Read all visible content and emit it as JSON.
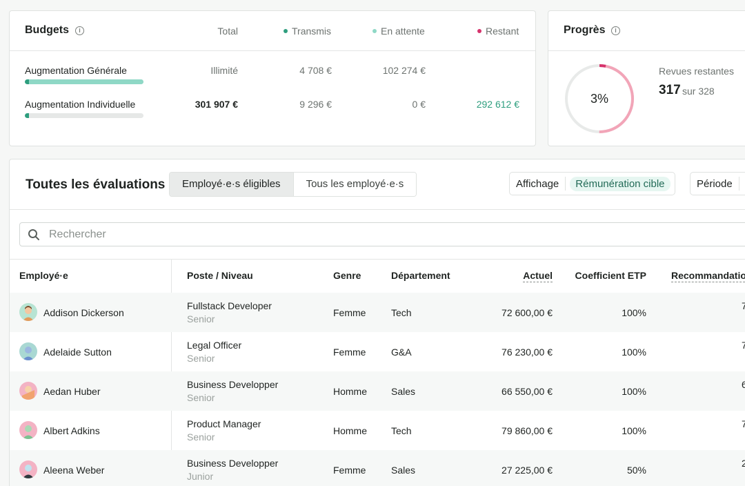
{
  "budgets": {
    "title": "Budgets",
    "columns": {
      "total": "Total",
      "transmis": "Transmis",
      "en_attente": "En attente",
      "restant": "Restant"
    },
    "colors": {
      "transmis": "#2e9e7e",
      "en_attente": "#8fd8c6",
      "restant": "#d6336c"
    },
    "rows": [
      {
        "label": "Augmentation Générale",
        "total": "Illimité",
        "transmis": "4 708 €",
        "en_attente": "102 274 €",
        "restant": "",
        "progress": 1.0
      },
      {
        "label": "Augmentation Individuelle",
        "total": "301 907 €",
        "transmis": "9 296 €",
        "en_attente": "0 €",
        "restant": "292 612 €",
        "progress": 0.03
      }
    ]
  },
  "progress": {
    "title": "Progrès",
    "percent_label": "3%",
    "percent": 0.03,
    "remaining_label": "Revues restantes",
    "remaining": "317",
    "total": "sur 328"
  },
  "evaluations": {
    "title": "Toutes les évaluations",
    "tabs": [
      "Employé·e·s éligibles",
      "Tous les employé·e·s"
    ],
    "display_label": "Affichage",
    "display_value": "Rémunération cible",
    "period_label": "Période",
    "search_placeholder": "Rechercher",
    "headers": {
      "employee": "Employé·e",
      "position": "Poste / Niveau",
      "gender": "Genre",
      "department": "Département",
      "current": "Actuel",
      "fte": "Coefficient ETP",
      "recommendation": "Recommandation"
    },
    "rows": [
      {
        "name": "Addison Dickerson",
        "role": "Fullstack Developer",
        "level": "Senior",
        "gender": "Femme",
        "dept": "Tech",
        "current": "72 600,00 €",
        "fte": "100%",
        "rec": "7"
      },
      {
        "name": "Adelaide Sutton",
        "role": "Legal Officer",
        "level": "Senior",
        "gender": "Femme",
        "dept": "G&A",
        "current": "76 230,00 €",
        "fte": "100%",
        "rec": "7"
      },
      {
        "name": "Aedan Huber",
        "role": "Business Developper",
        "level": "Senior",
        "gender": "Homme",
        "dept": "Sales",
        "current": "66 550,00 €",
        "fte": "100%",
        "rec": "6"
      },
      {
        "name": "Albert Adkins",
        "role": "Product Manager",
        "level": "Senior",
        "gender": "Homme",
        "dept": "Tech",
        "current": "79 860,00 €",
        "fte": "100%",
        "rec": "7"
      },
      {
        "name": "Aleena Weber",
        "role": "Business Developper",
        "level": "Junior",
        "gender": "Femme",
        "dept": "Sales",
        "current": "27 225,00 €",
        "fte": "50%",
        "rec": "2"
      }
    ]
  }
}
